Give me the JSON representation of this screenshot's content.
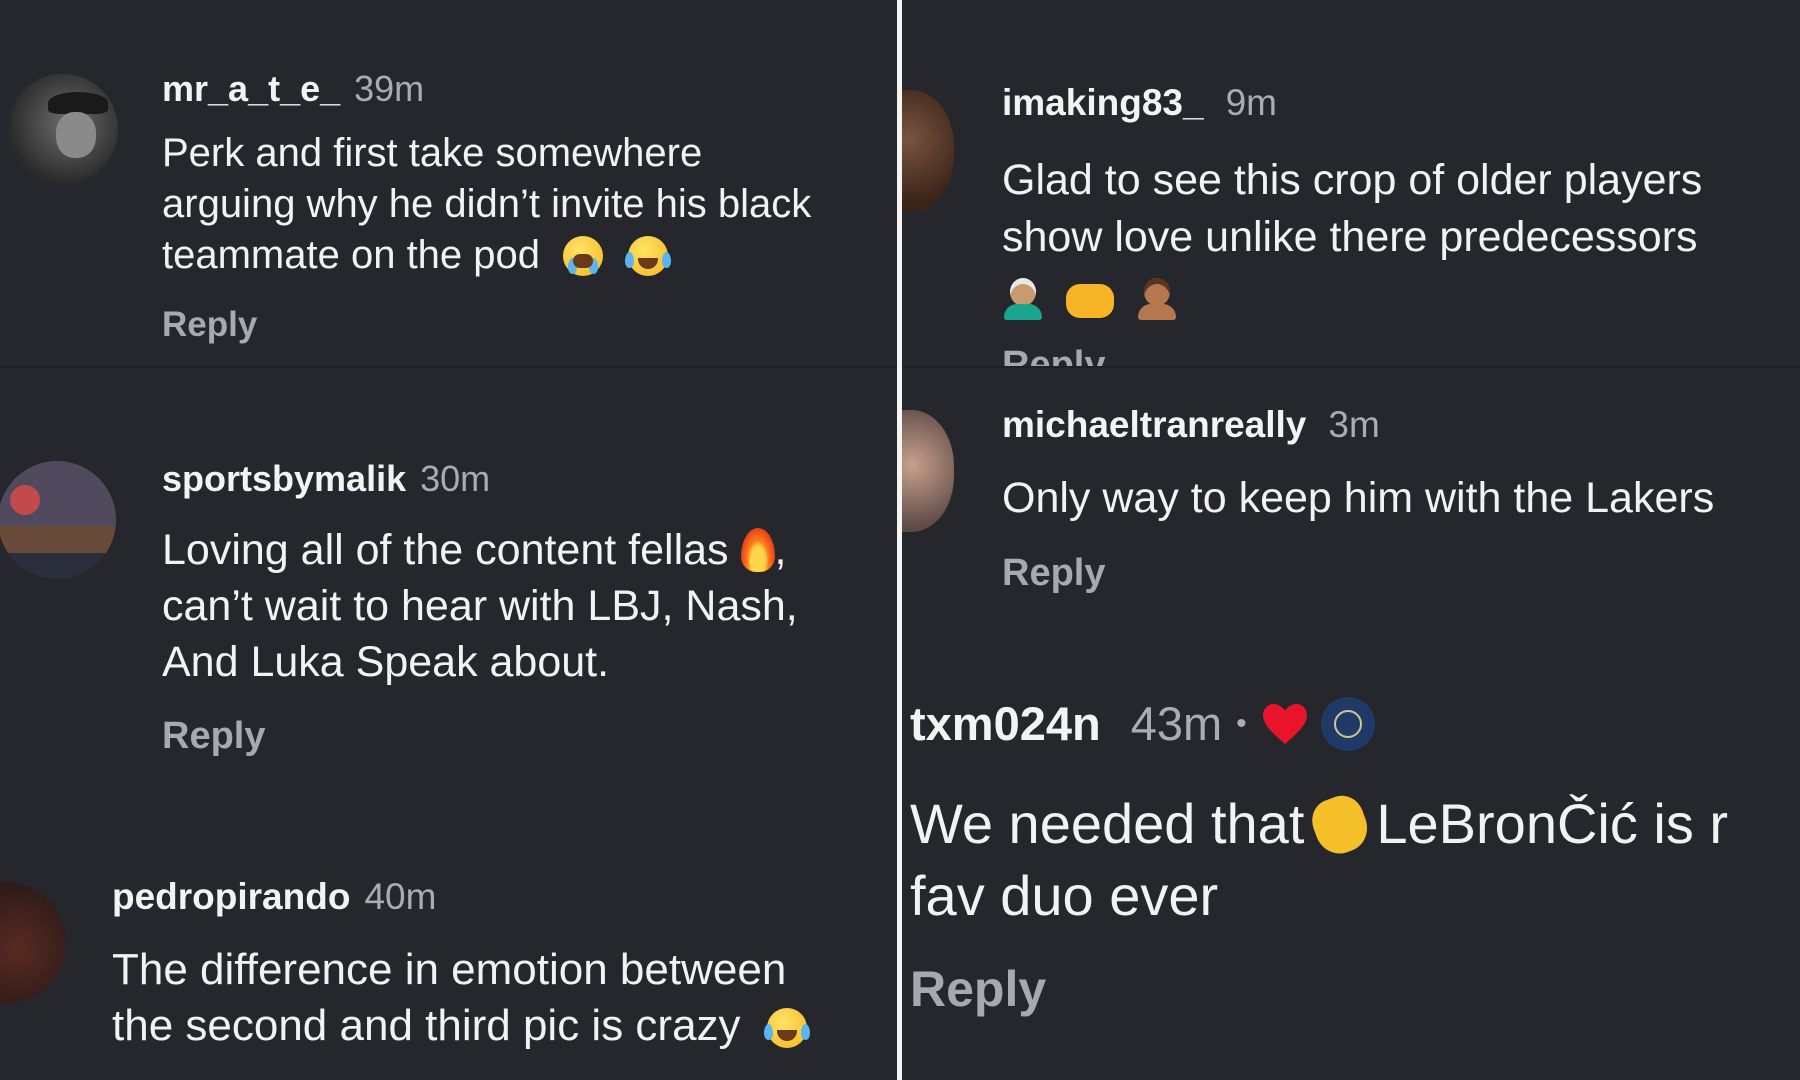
{
  "comments": [
    {
      "user": "mr_a_t_e_",
      "time": "39m",
      "lines": [
        "Perk and first take somewhere",
        "arguing  why he didn’t invite his black",
        "teammate on the pod"
      ],
      "reply": "Reply"
    },
    {
      "user": "sportsbymalik",
      "time": "30m",
      "lines": [
        "Loving all of the content fellas",
        "can’t wait to hear with LBJ, Nash,",
        "And Luka Speak about."
      ],
      "trail": ",",
      "reply": "Reply"
    },
    {
      "user": "pedropirando",
      "time": "40m",
      "lines": [
        "The difference in emotion between",
        "the second and third pic is crazy"
      ]
    },
    {
      "user": "imaking83_",
      "time": "9m",
      "lines": [
        "Glad to see this crop of older players",
        "show love unlike there predecessors"
      ],
      "reply": "Reply"
    },
    {
      "user": "michaeltranreally",
      "time": "3m",
      "lines": [
        "Only way to keep him with the Lakers"
      ],
      "reply": "Reply"
    },
    {
      "user": "txm024n",
      "time": "43m",
      "dot": "•",
      "lines": [
        "We needed that",
        "LeBronČić is r",
        "fav duo ever"
      ],
      "reply": "Reply"
    }
  ],
  "icons": {
    "crying": "loudly-crying-face-icon",
    "laughing": "face-with-tears-of-joy-icon",
    "fire": "fire-icon",
    "older_man": "older-man-icon",
    "handshake": "handshake-icon",
    "man": "man-icon",
    "clap": "clapping-hands-icon",
    "heart": "red-heart-icon",
    "badge": "verified-badge-icon"
  }
}
